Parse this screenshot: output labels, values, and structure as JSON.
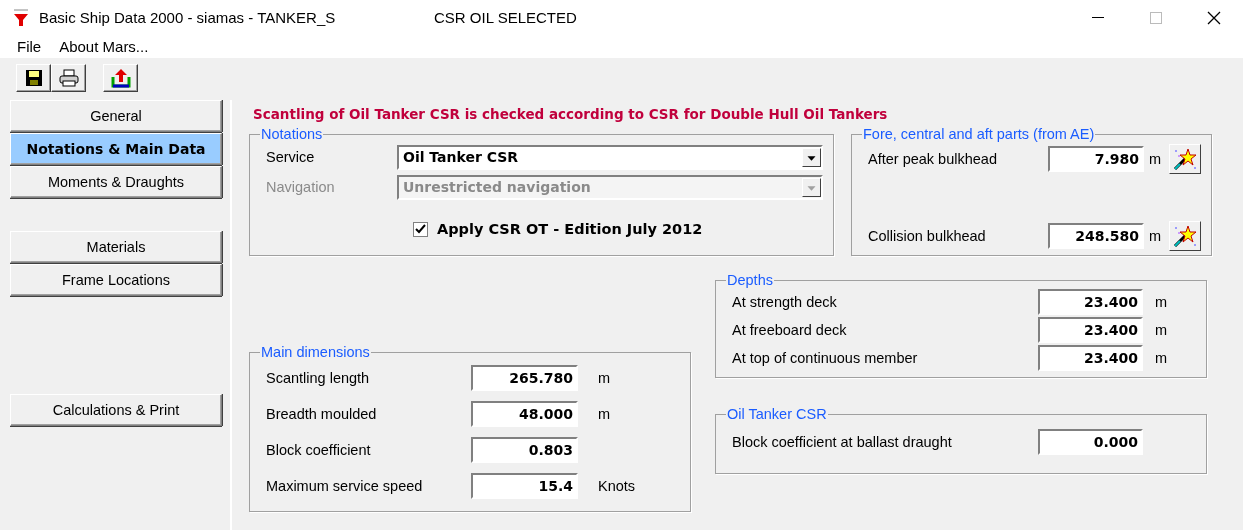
{
  "window": {
    "title": "Basic Ship Data 2000 - siamas - TANKER_S",
    "status": "CSR OIL SELECTED"
  },
  "menu": [
    "File",
    "About Mars..."
  ],
  "sidebar": {
    "groups": [
      [
        {
          "label": "General",
          "selected": false
        },
        {
          "label": "Notations & Main Data",
          "selected": true
        },
        {
          "label": "Moments & Draughts",
          "selected": false
        }
      ],
      [
        {
          "label": "Materials",
          "selected": false
        },
        {
          "label": "Frame Locations",
          "selected": false
        }
      ],
      [
        {
          "label": "Calculations & Print",
          "selected": false
        }
      ]
    ]
  },
  "heading": "Scantling of Oil Tanker CSR is checked according to CSR for Double Hull Oil Tankers",
  "notations": {
    "title": "Notations",
    "fields": [
      {
        "label": "Service",
        "value": "Oil Tanker CSR",
        "disabled": false
      },
      {
        "label": "Navigation",
        "value": "Unrestricted navigation",
        "disabled": true
      }
    ],
    "checkbox": {
      "label": "Apply CSR OT - Edition July 2012",
      "checked": true
    }
  },
  "fore_parts": {
    "title": "Fore, central and aft parts (from AE)",
    "rows": [
      {
        "label": "After peak bulkhead",
        "value": "7.980",
        "unit": "m"
      },
      {
        "label": "Collision bulkhead",
        "value": "248.580",
        "unit": "m"
      }
    ]
  },
  "depths": {
    "title": "Depths",
    "rows": [
      {
        "label": "At strength deck",
        "value": "23.400",
        "unit": "m"
      },
      {
        "label": "At freeboard deck",
        "value": "23.400",
        "unit": "m"
      },
      {
        "label": "At top of continuous member",
        "value": "23.400",
        "unit": "m"
      }
    ]
  },
  "main_dimensions": {
    "title": "Main dimensions",
    "rows": [
      {
        "label": "Scantling length",
        "value": "265.780",
        "unit": "m"
      },
      {
        "label": "Breadth moulded",
        "value": "48.000",
        "unit": "m"
      },
      {
        "label": "Block coefficient",
        "value": "0.803"
      },
      {
        "label": "Maximum service speed",
        "value": "15.4",
        "unit": "Knots"
      }
    ]
  },
  "oil_tanker_csr": {
    "title": "Oil Tanker CSR",
    "rows": [
      {
        "label": "Block coefficient at ballast draught",
        "value": "0.000"
      }
    ]
  }
}
